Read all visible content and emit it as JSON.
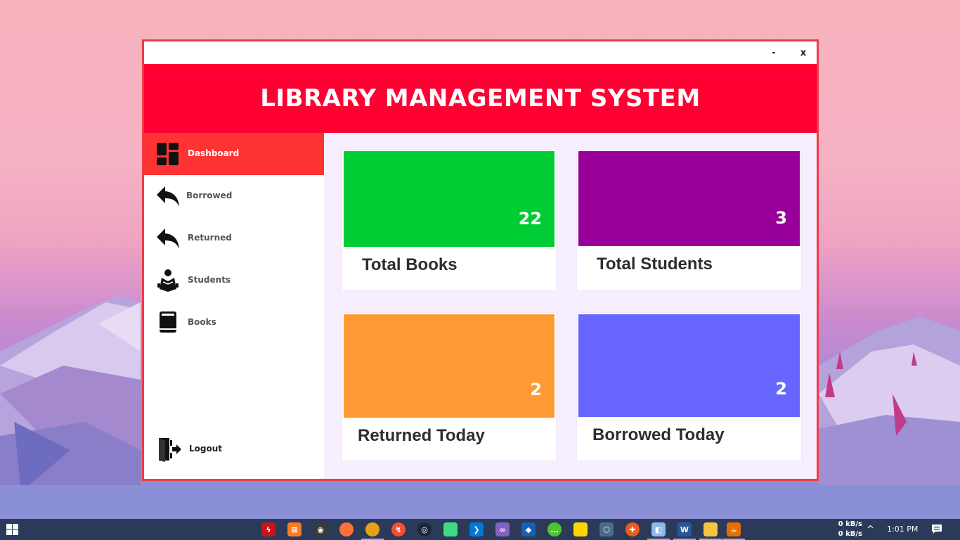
{
  "window": {
    "minimize_label": "-",
    "close_label": "x",
    "banner_title": "LIBRARY MANAGEMENT SYSTEM",
    "border_color": "#ef3b46",
    "banner_color": "#ff0033"
  },
  "sidebar": {
    "items": [
      {
        "label": "Dashboard",
        "icon": "dashboard-icon",
        "active": true
      },
      {
        "label": "Borrowed",
        "icon": "reply-arrow-icon",
        "active": false
      },
      {
        "label": "Returned",
        "icon": "reply-arrow-icon",
        "active": false
      },
      {
        "label": "Students",
        "icon": "student-reading-icon",
        "active": false
      },
      {
        "label": "Books",
        "icon": "book-icon",
        "active": false
      }
    ],
    "logout_label": "Logout",
    "logout_icon": "logout-door-icon",
    "active_color": "#ff3333"
  },
  "cards": [
    {
      "label": "Total Books",
      "count": "22",
      "color": "#00cc33"
    },
    {
      "label": "Total Students",
      "count": "3",
      "color": "#990099"
    },
    {
      "label": "Returned Today",
      "count": "2",
      "color": "#ff9933"
    },
    {
      "label": "Borrowed Today",
      "count": "2",
      "color": "#6666ff"
    }
  ],
  "taskbar": {
    "apps": [
      "flash-icon",
      "xampp-icon",
      "obs-icon",
      "firefox-icon",
      "chrome-icon",
      "git-icon",
      "steam-icon",
      "android-studio-icon",
      "vscode-icon",
      "visual-studio-icon",
      "virtualbox-icon",
      "wechat-icon",
      "sticky-notes-icon",
      "cube-icon",
      "network-icon",
      "box-icon",
      "word-icon",
      "file-explorer-icon",
      "java-icon"
    ],
    "net_up": "0 kB/s",
    "net_down": "0 kB/s",
    "tray_chevron": "^",
    "clock": "1:01 PM"
  }
}
